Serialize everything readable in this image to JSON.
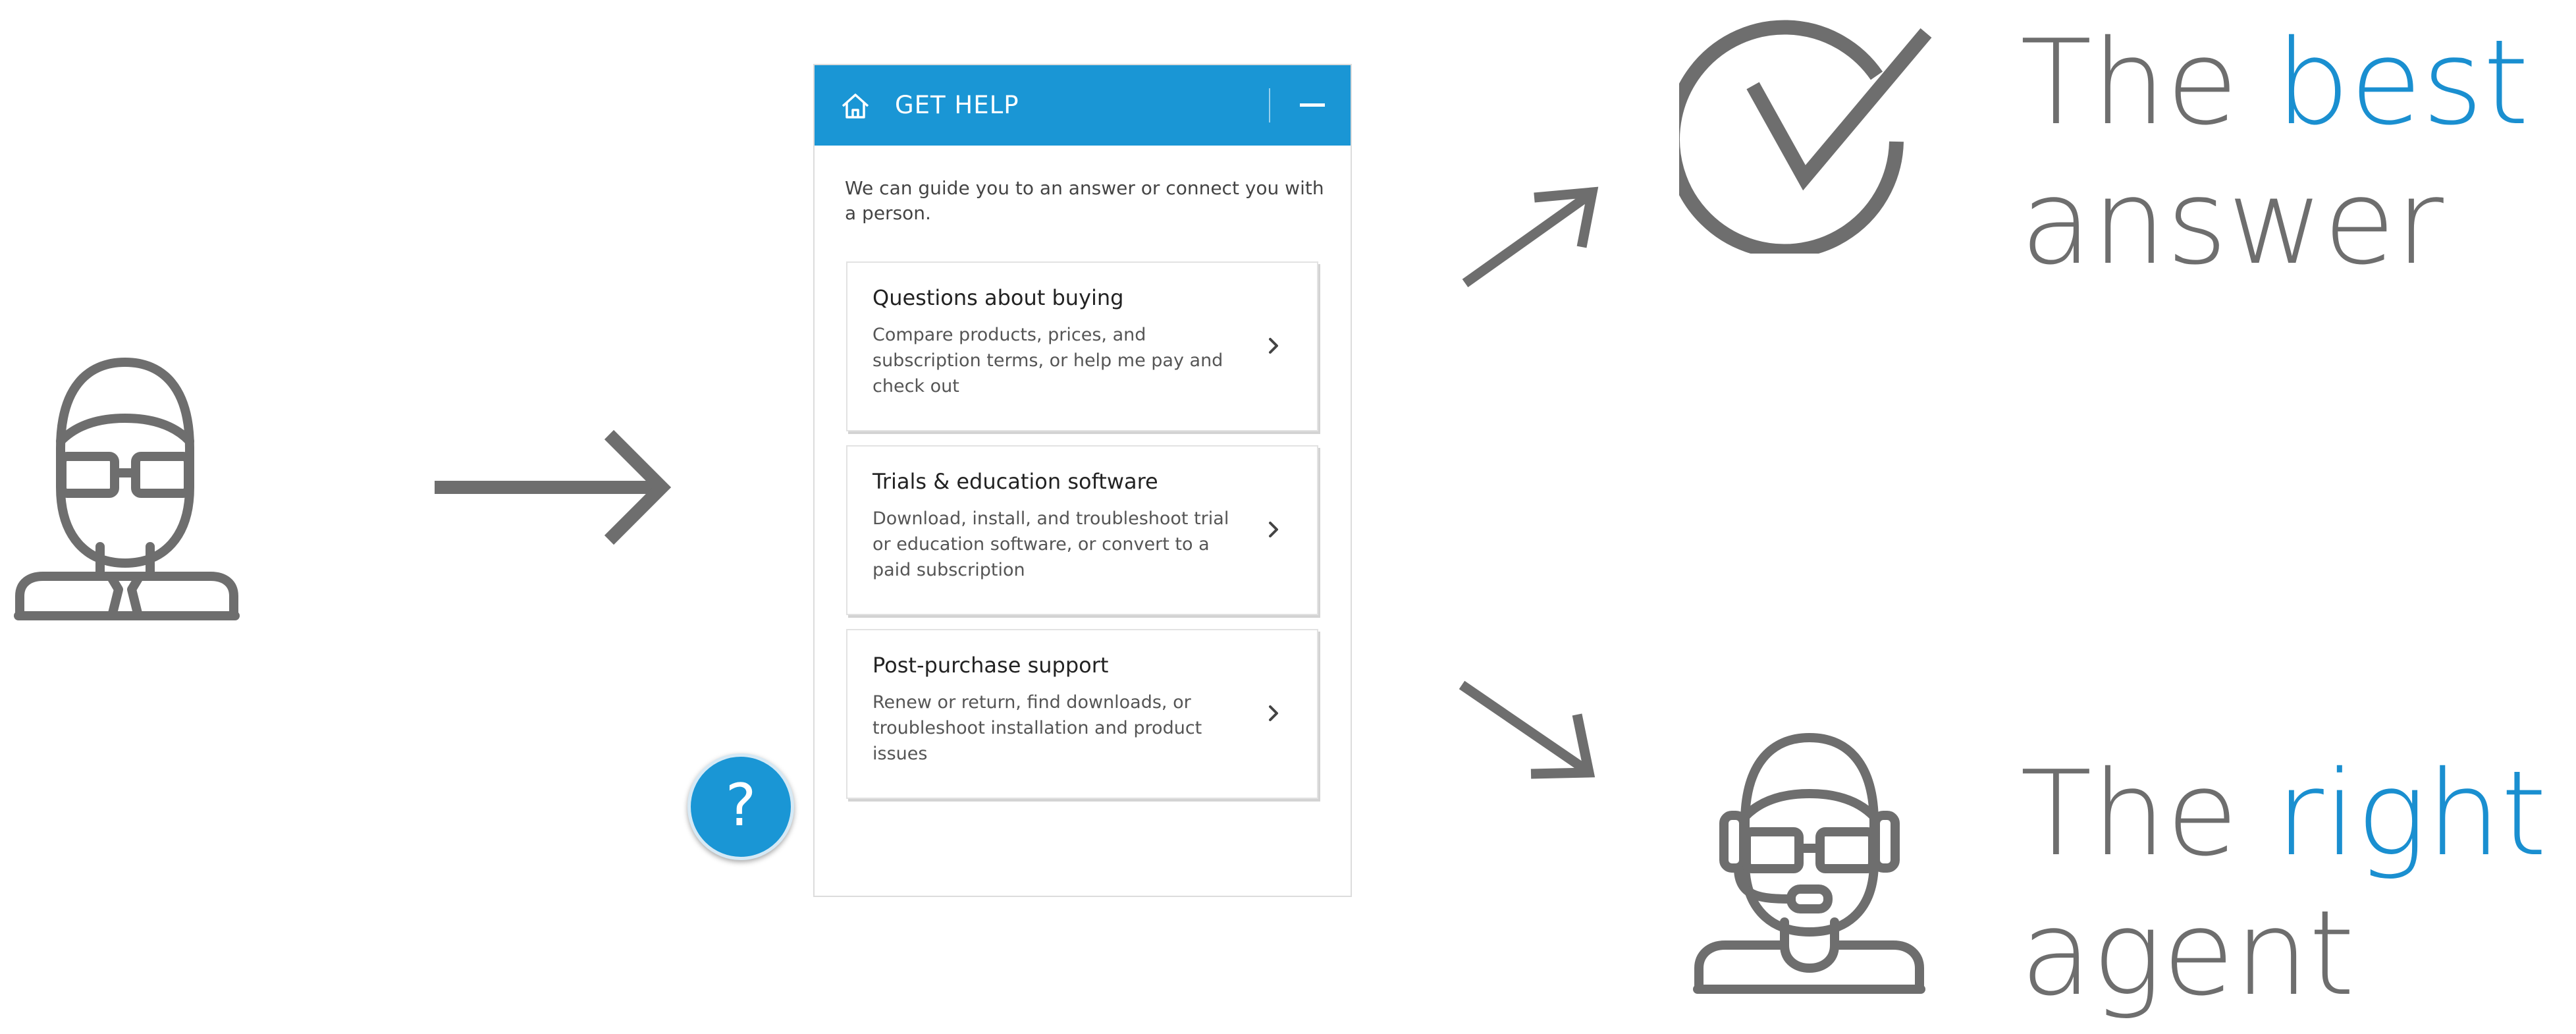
{
  "colors": {
    "accent": "#1a96d5",
    "icon_gray": "#6e6e6e",
    "headline_accent": "#1a8fd0"
  },
  "icons": {
    "user": "user-icon",
    "arrow_right": "arrow-right-icon",
    "arrow_up_right": "arrow-up-right-icon",
    "arrow_down_right": "arrow-down-right-icon",
    "checkmark": "checkmark-circle-icon",
    "agent": "support-agent-headset-icon"
  },
  "widget": {
    "title": "GET HELP",
    "home_icon": "home-icon",
    "minimize_icon": "minimize-icon",
    "intro": "We can guide you to an answer or connect you with a person.",
    "cards": [
      {
        "title": "Questions about buying",
        "description": "Compare products, prices, and subscription terms, or help me pay and check out"
      },
      {
        "title": "Trials & education software",
        "description": "Download, install, and troubleshoot trial or education software, or convert to a paid subscription"
      },
      {
        "title": "Post-purchase support",
        "description": "Renew or return, find downloads, or troubleshoot installation and product issues"
      }
    ],
    "help_button": "?"
  },
  "outcomes": {
    "best": {
      "prefix": "The",
      "accent": "best",
      "suffix": "answer"
    },
    "right": {
      "prefix": "The",
      "accent": "right",
      "suffix": "agent"
    }
  }
}
